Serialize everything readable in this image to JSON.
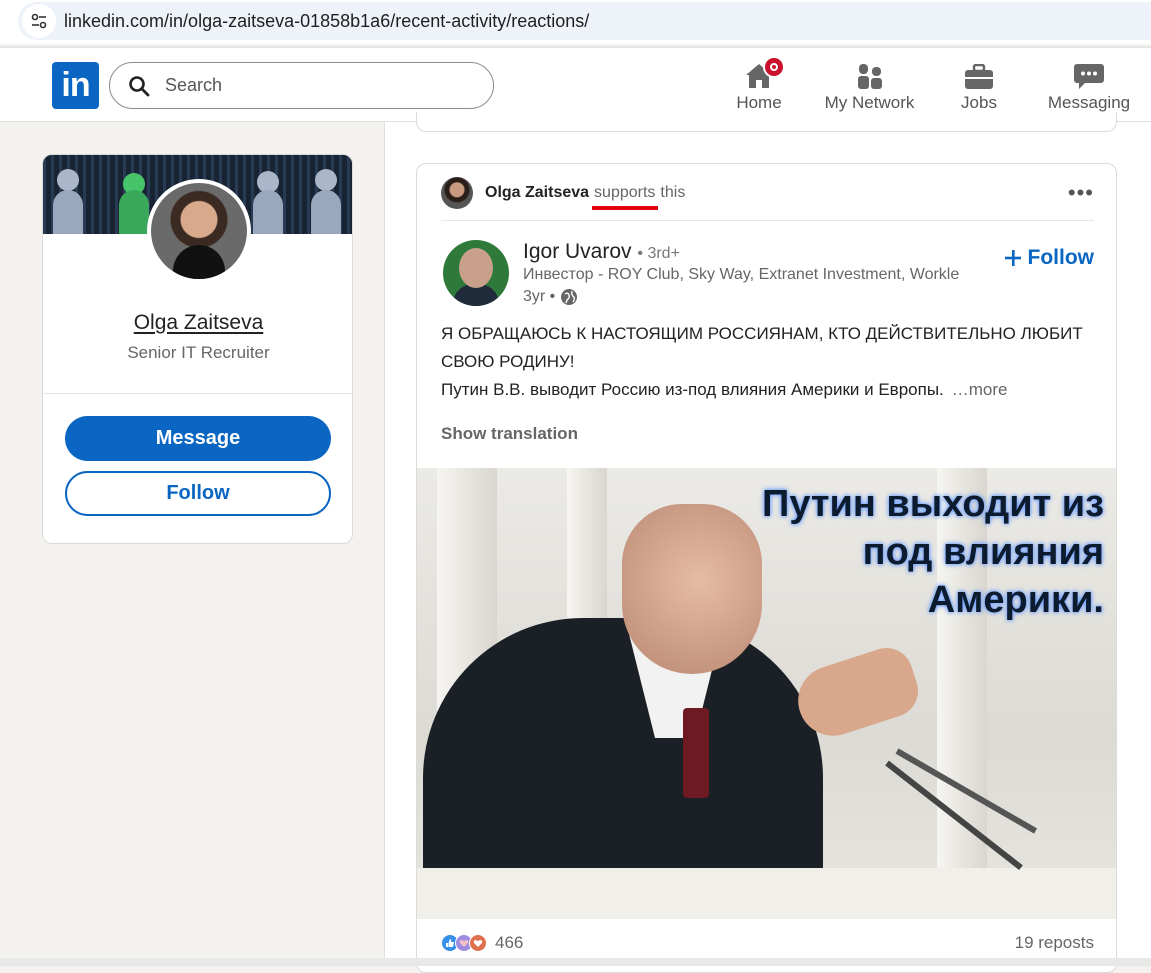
{
  "browser": {
    "url": "linkedin.com/in/olga-zaitseva-01858b1a6/recent-activity/reactions/"
  },
  "nav": {
    "logo": "in",
    "search_placeholder": "Search",
    "items": [
      {
        "label": "Home",
        "icon": "home-icon",
        "has_badge": true
      },
      {
        "label": "My Network",
        "icon": "network-icon"
      },
      {
        "label": "Jobs",
        "icon": "briefcase-icon"
      },
      {
        "label": "Messaging",
        "icon": "messaging-icon"
      }
    ]
  },
  "profile": {
    "name": "Olga Zaitseva",
    "title": "Senior IT Recruiter",
    "message_label": "Message",
    "follow_label": "Follow"
  },
  "post": {
    "reactor_name": "Olga Zaitseva",
    "reaction_word": "supports",
    "reaction_suffix": "this",
    "author": {
      "name": "Igor Uvarov",
      "degree": "• 3rd+",
      "headline": "Инвестор - ROY Club, Sky Way, Extranet Investment, Workle",
      "time": "3yr •",
      "follow_label": "Follow"
    },
    "text_line1": "Я ОБРАЩАЮСЬ К НАСТОЯЩИМ РОССИЯНАМ, КТО ДЕЙСТВИТЕЛЬНО ЛЮБИТ СВОЮ РОДИНУ!",
    "text_line2": "Путин В.В. выводит Россию из-под влияния Америки и Европы.",
    "more_label": "…more",
    "translation_label": "Show translation",
    "image_caption": [
      "Путин выходит из",
      "под влияния",
      "Америки."
    ],
    "reaction_count": "466",
    "reposts": "19 reposts",
    "colors": {
      "accent": "#0a66c2",
      "highlight": "#e3000f"
    }
  }
}
